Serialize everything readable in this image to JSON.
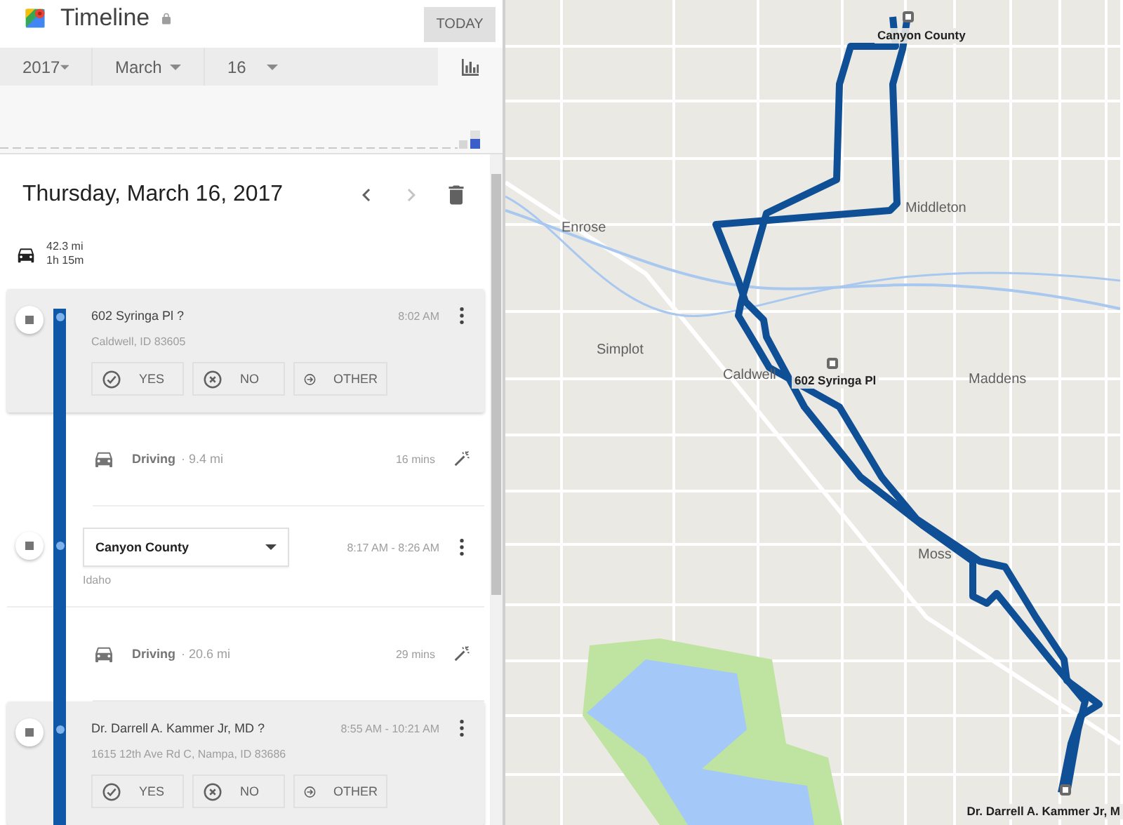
{
  "header": {
    "title": "Timeline",
    "today_button": "TODAY"
  },
  "date_picker": {
    "year": "2017",
    "month": "March",
    "day": "16"
  },
  "day": {
    "heading": "Thursday, March 16, 2017",
    "distance": "42.3 mi",
    "duration": "1h 15m"
  },
  "timeline": [
    {
      "kind": "suggested",
      "title": "602 Syringa Pl ?",
      "time": "8:02 AM",
      "subtitle": "Caldwell, ID 83605",
      "actions": [
        "YES",
        "NO",
        "OTHER"
      ]
    },
    {
      "kind": "drive",
      "label": "Driving",
      "distance": "· 9.4 mi",
      "duration": "16 mins"
    },
    {
      "kind": "edit",
      "title": "Canyon County",
      "time": "8:17 AM - 8:26 AM",
      "subtitle": "Idaho"
    },
    {
      "kind": "drive",
      "label": "Driving",
      "distance": "· 20.6 mi",
      "duration": "29 mins"
    },
    {
      "kind": "suggested",
      "title": "Dr. Darrell A. Kammer Jr, MD ?",
      "time": "8:55 AM - 10:21 AM",
      "subtitle": "1615 12th Ave Rd C, Nampa, ID 83686",
      "actions": [
        "YES",
        "NO",
        "OTHER"
      ]
    }
  ],
  "map": {
    "places": [
      {
        "kind": "pin",
        "name": "Canyon County"
      },
      {
        "kind": "town",
        "name": "Middleton"
      },
      {
        "kind": "town",
        "name": "Enrose"
      },
      {
        "kind": "town",
        "name": "Simplot"
      },
      {
        "kind": "town",
        "name": "Caldwell"
      },
      {
        "kind": "pin",
        "name": "602 Syringa Pl"
      },
      {
        "kind": "town",
        "name": "Maddens"
      },
      {
        "kind": "town",
        "name": "Moss"
      },
      {
        "kind": "pin",
        "name": "Dr. Darrell A. Kammer Jr, M"
      }
    ]
  }
}
